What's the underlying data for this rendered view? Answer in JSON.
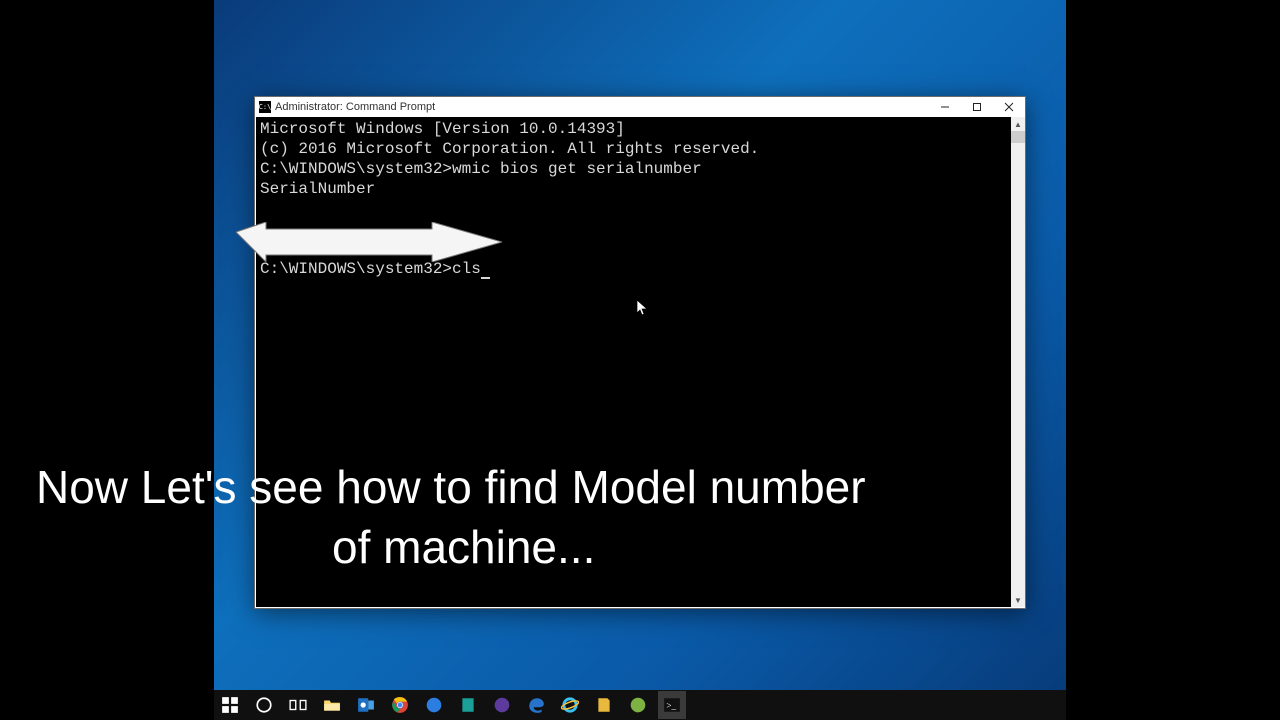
{
  "window": {
    "title": "Administrator: Command Prompt",
    "icon_label": "C:\\"
  },
  "cmd": {
    "line1": "Microsoft Windows [Version 10.0.14393]",
    "line2": "(c) 2016 Microsoft Corporation. All rights reserved.",
    "blank": "",
    "prompt1": "C:\\WINDOWS\\system32>wmic bios get serialnumber",
    "header": "SerialNumber",
    "prompt2_prefix": "C:\\WINDOWS\\system32>",
    "prompt2_cmd": "cls"
  },
  "caption": {
    "line1": "Now Let's see how to find Model number",
    "line2": "of machine..."
  },
  "taskbar": {
    "items": [
      {
        "name": "start-icon"
      },
      {
        "name": "cortana-search-icon"
      },
      {
        "name": "task-view-icon"
      },
      {
        "name": "file-explorer-icon"
      },
      {
        "name": "outlook-icon"
      },
      {
        "name": "chrome-icon"
      },
      {
        "name": "app-blue-icon"
      },
      {
        "name": "app-teal-icon"
      },
      {
        "name": "app-purple-icon"
      },
      {
        "name": "edge-icon"
      },
      {
        "name": "ie-icon"
      },
      {
        "name": "app-yellow-icon"
      },
      {
        "name": "app-green-icon"
      },
      {
        "name": "cmd-icon"
      }
    ]
  }
}
